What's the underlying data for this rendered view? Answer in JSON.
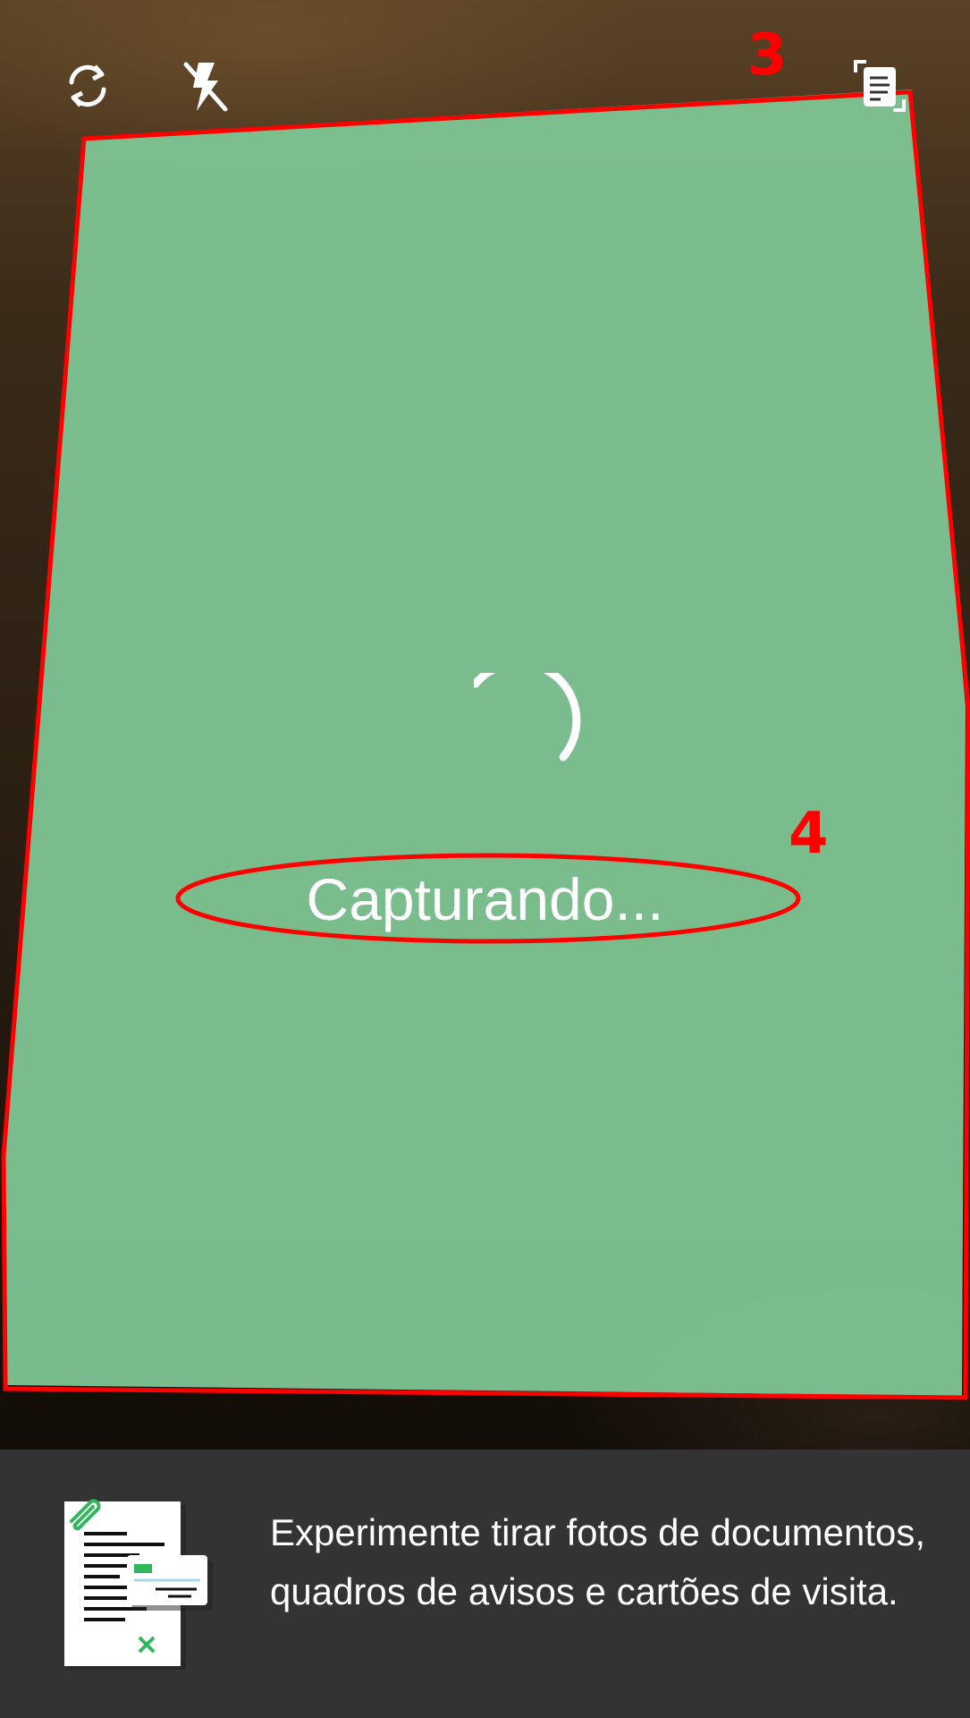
{
  "camera": {
    "rotate_icon": "rotate-camera-icon",
    "flash_icon": "flash-off-icon",
    "doc_mode_icon": "document-scan-mode-icon",
    "status_text": "Capturando...",
    "spinner_icon": "loading-spinner-icon",
    "document_overlay_color": "#7fd39a"
  },
  "annotations": {
    "marker_3": "3",
    "marker_4": "4",
    "marker_color": "#ff0000"
  },
  "tip": {
    "illustration": "documents-illustration",
    "text": "Experimente tirar fotos de documentos, quadros de avisos e cartões de visita."
  }
}
